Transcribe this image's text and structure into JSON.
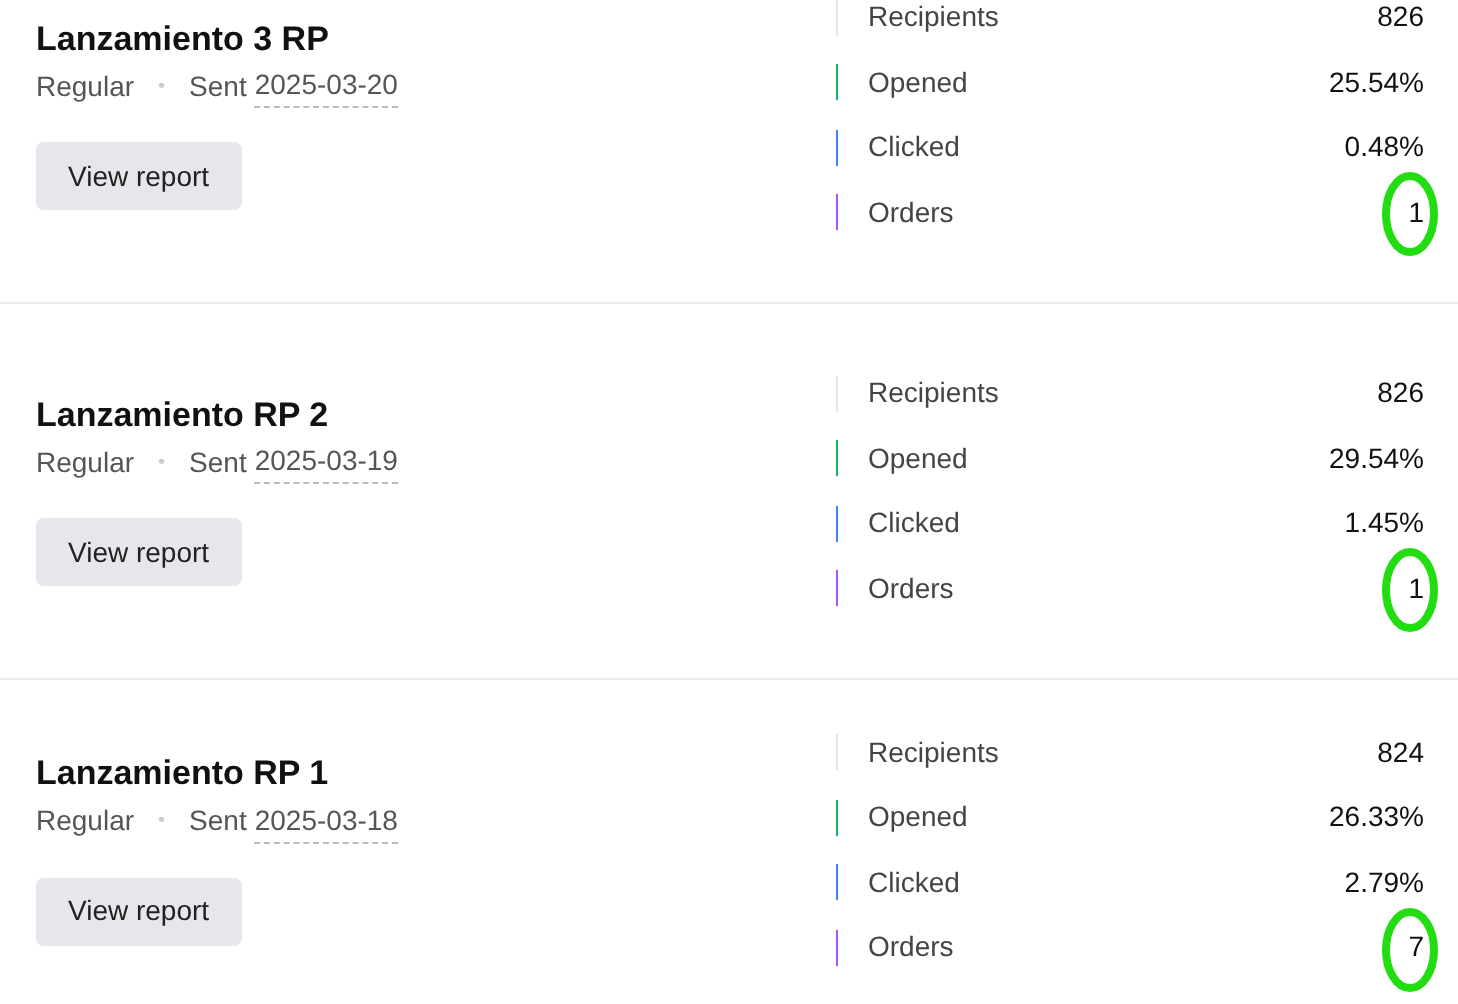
{
  "campaigns": [
    {
      "title": "Lanzamiento 3 RP",
      "type": "Regular",
      "separator": "•",
      "sent_label": "Sent",
      "sent_date": "2025-03-20",
      "button": "View report",
      "metrics": [
        {
          "label": "Recipients",
          "value": "826",
          "color": "#e4e4e7",
          "circled": false
        },
        {
          "label": "Opened",
          "value": "25.54%",
          "color": "#16b364",
          "circled": false
        },
        {
          "label": "Clicked",
          "value": "0.48%",
          "color": "#3b82f6",
          "circled": false
        },
        {
          "label": "Orders",
          "value": "1",
          "color": "#a855f7",
          "circled": true
        }
      ]
    },
    {
      "title": "Lanzamiento RP 2",
      "type": "Regular",
      "separator": "•",
      "sent_label": "Sent",
      "sent_date": "2025-03-19",
      "button": "View report",
      "metrics": [
        {
          "label": "Recipients",
          "value": "826",
          "color": "#e4e4e7",
          "circled": false
        },
        {
          "label": "Opened",
          "value": "29.54%",
          "color": "#16b364",
          "circled": false
        },
        {
          "label": "Clicked",
          "value": "1.45%",
          "color": "#3b82f6",
          "circled": false
        },
        {
          "label": "Orders",
          "value": "1",
          "color": "#a855f7",
          "circled": true
        }
      ]
    },
    {
      "title": "Lanzamiento RP 1",
      "type": "Regular",
      "separator": "•",
      "sent_label": "Sent",
      "sent_date": "2025-03-18",
      "button": "View report",
      "metrics": [
        {
          "label": "Recipients",
          "value": "824",
          "color": "#e4e4e7",
          "circled": false
        },
        {
          "label": "Opened",
          "value": "26.33%",
          "color": "#16b364",
          "circled": false
        },
        {
          "label": "Clicked",
          "value": "2.79%",
          "color": "#3b82f6",
          "circled": false
        },
        {
          "label": "Orders",
          "value": "7",
          "color": "#a855f7",
          "circled": true
        }
      ]
    }
  ]
}
